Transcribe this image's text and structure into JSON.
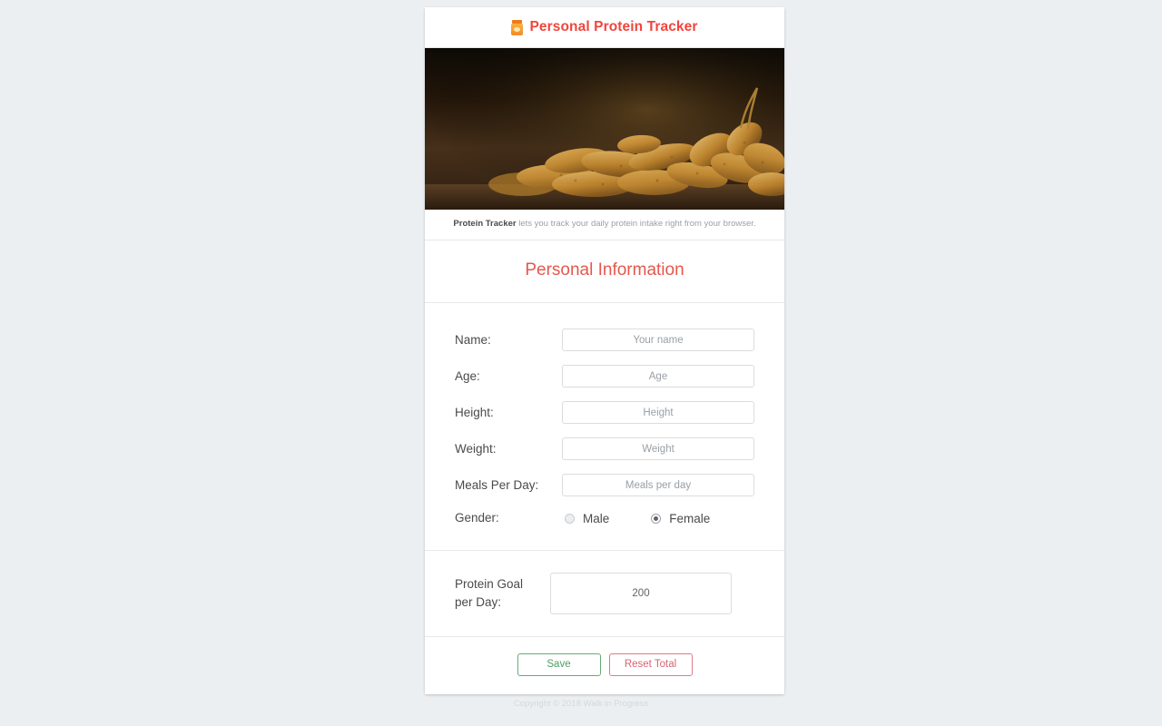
{
  "app": {
    "title": "Personal Protein Tracker",
    "title_icon": "jar-icon"
  },
  "hero": {
    "alt": "peanuts-in-shells-photo"
  },
  "caption": {
    "strong": "Protein Tracker",
    "rest": " lets you track your daily protein intake right from your browser."
  },
  "section": {
    "title": "Personal Information"
  },
  "form": {
    "fields": [
      {
        "label": "Name:",
        "placeholder": "Your name",
        "value": ""
      },
      {
        "label": "Age:",
        "placeholder": "Age",
        "value": ""
      },
      {
        "label": "Height:",
        "placeholder": "Height",
        "value": ""
      },
      {
        "label": "Weight:",
        "placeholder": "Weight",
        "value": ""
      },
      {
        "label": "Meals Per Day:",
        "placeholder": "Meals per day",
        "value": ""
      }
    ],
    "gender": {
      "label": "Gender:",
      "options": [
        {
          "label": "Male",
          "selected": false
        },
        {
          "label": "Female",
          "selected": true
        }
      ]
    }
  },
  "goal": {
    "label": "Protein Goal per Day:",
    "value": "200",
    "placeholder": "200"
  },
  "actions": {
    "save_label": "Save",
    "reset_label": "Reset Total"
  },
  "footer": {
    "copyright": "Copyright © 2018 Walk in Progress"
  },
  "colors": {
    "page_background": "#eceff1",
    "brand_red": "#f1453d",
    "section_heading": "#e4584d",
    "save_green": "#4f9d60",
    "reset_red": "#d9636f",
    "text": "#4a4a4a",
    "placeholder": "#9aa0a6"
  }
}
